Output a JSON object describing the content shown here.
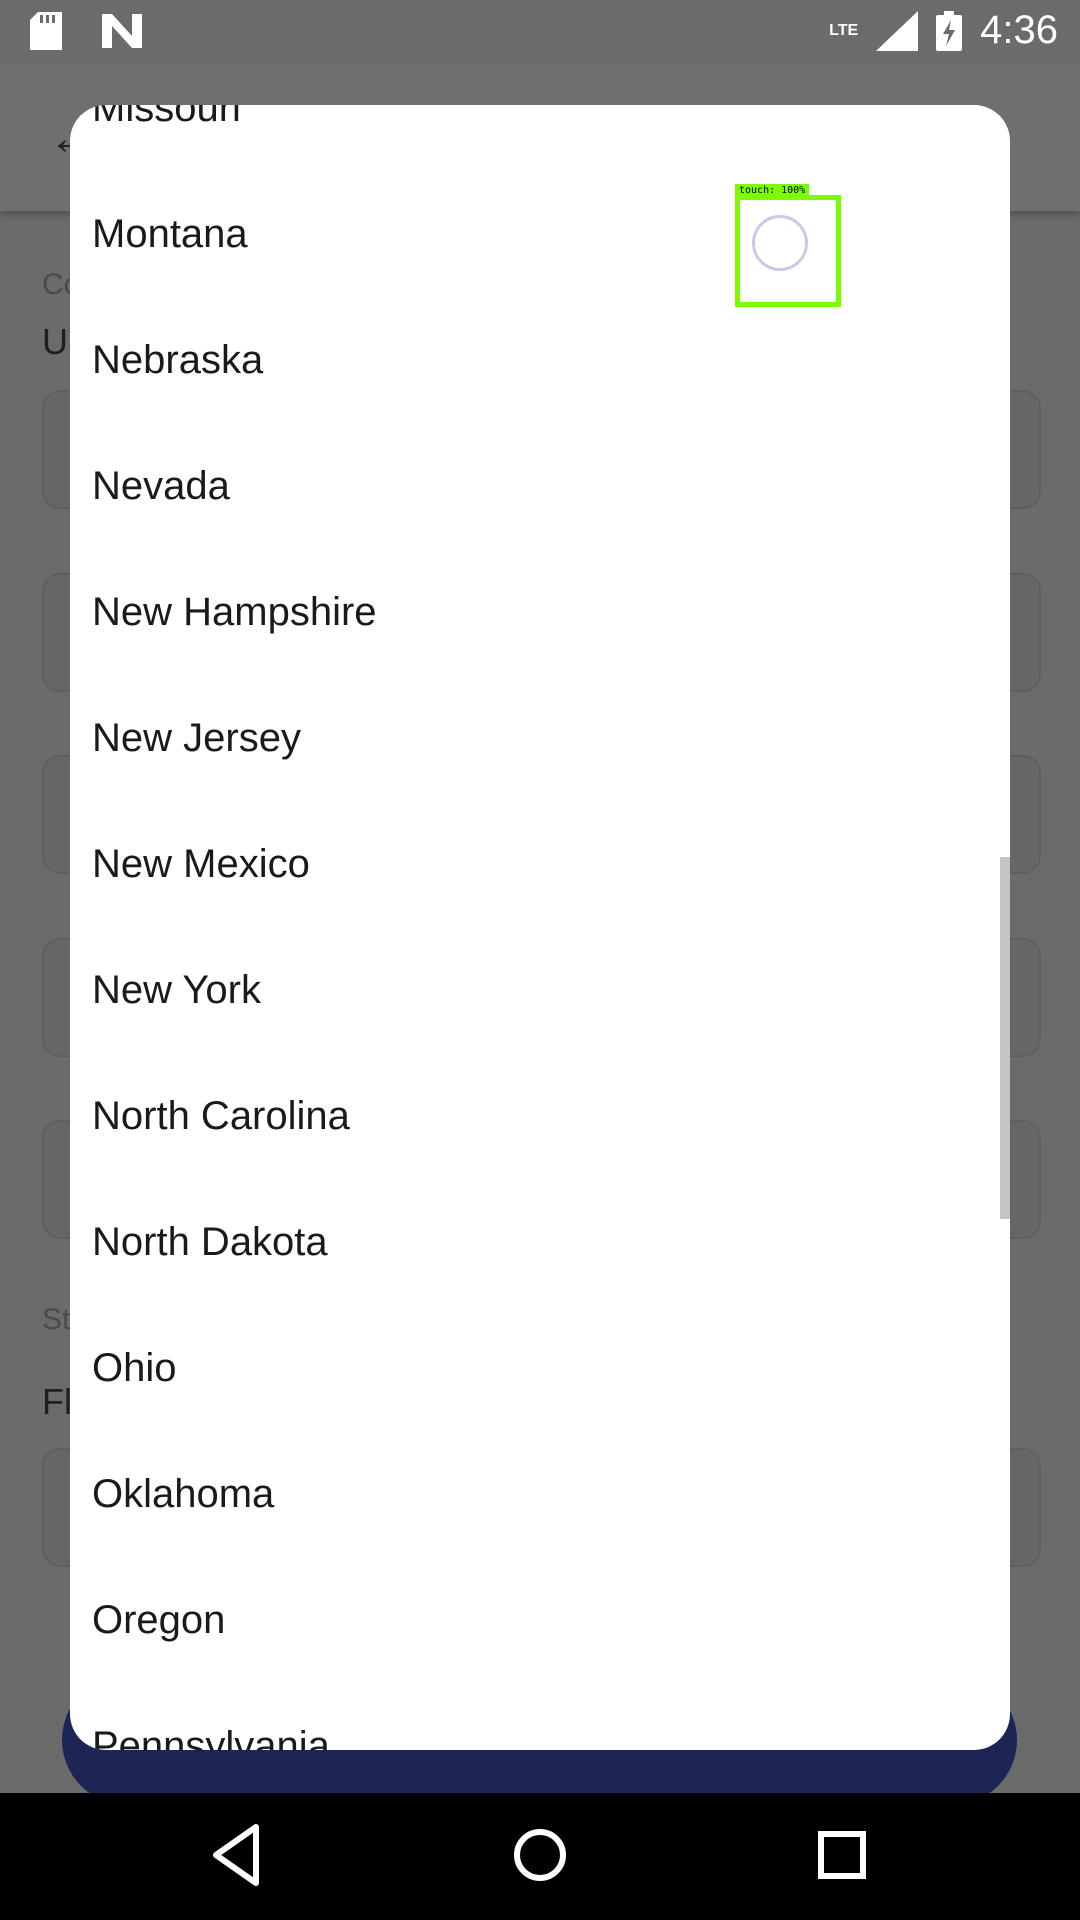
{
  "status_bar": {
    "time": "4:36",
    "network": "LTE",
    "icons": [
      "sd-card-icon",
      "n-logo-icon",
      "signal-icon",
      "battery-charging-icon"
    ]
  },
  "background": {
    "labels": [
      "Co",
      "St"
    ],
    "values": [
      "Ur",
      "Fl"
    ]
  },
  "dialog": {
    "items": [
      "Missouri",
      "Montana",
      "Nebraska",
      "Nevada",
      "New Hampshire",
      "New Jersey",
      "New Mexico",
      "New York",
      "North Carolina",
      "North Dakota",
      "Ohio",
      "Oklahoma",
      "Oregon",
      "Pennsylvania"
    ]
  },
  "touch_indicator": {
    "label": "touch: 100%",
    "color": "#7cfc00"
  },
  "colors": {
    "scrim": "#6b6b6b",
    "primary_button": "#1d2557",
    "dialog_bg": "#ffffff"
  }
}
